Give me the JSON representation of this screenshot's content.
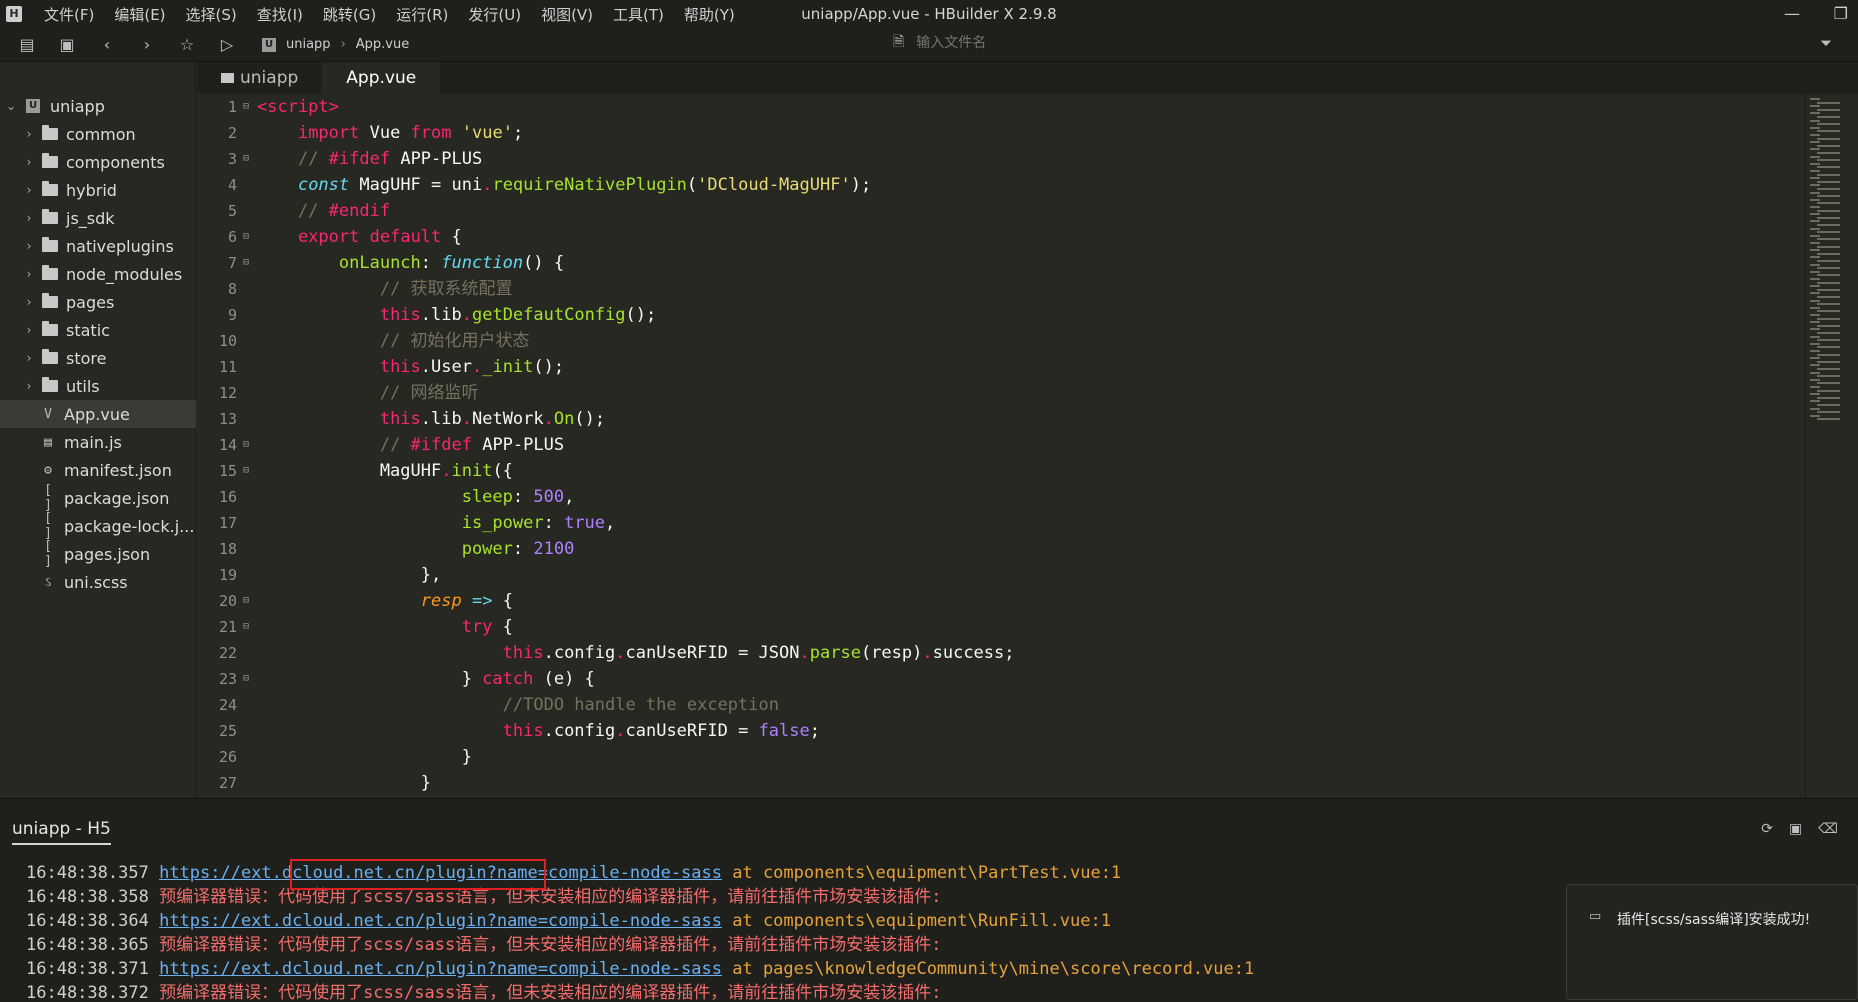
{
  "window": {
    "app_icon": "H",
    "title": "uniapp/App.vue - HBuilder X 2.9.8",
    "menu": [
      "文件(F)",
      "编辑(E)",
      "选择(S)",
      "查找(I)",
      "跳转(G)",
      "运行(R)",
      "发行(U)",
      "视图(V)",
      "工具(T)",
      "帮助(Y)"
    ]
  },
  "toolbar": {
    "breadcrumb_logo": "U",
    "breadcrumb": [
      "uniapp",
      "App.vue"
    ],
    "file_search_placeholder": "输入文件名"
  },
  "sidebar": {
    "root": "uniapp",
    "folders": [
      "common",
      "components",
      "hybrid",
      "js_sdk",
      "nativeplugins",
      "node_modules",
      "pages",
      "static",
      "store",
      "utils"
    ],
    "files": [
      {
        "name": "App.vue",
        "icon": "vue-file-icon",
        "glyph": "V",
        "selected": true
      },
      {
        "name": "main.js",
        "icon": "js-file-icon",
        "glyph": "▤",
        "selected": false
      },
      {
        "name": "manifest.json",
        "icon": "manifest-file-icon",
        "glyph": "⚙",
        "selected": false
      },
      {
        "name": "package.json",
        "icon": "json-file-icon",
        "glyph": "[ ]",
        "selected": false
      },
      {
        "name": "package-lock.j...",
        "icon": "json-file-icon",
        "glyph": "[ ]",
        "selected": false
      },
      {
        "name": "pages.json",
        "icon": "json-file-icon",
        "glyph": "[ ]",
        "selected": false
      },
      {
        "name": "uni.scss",
        "icon": "scss-file-icon",
        "glyph": "ઽ",
        "selected": false
      }
    ]
  },
  "tabs": [
    {
      "label": "uniapp",
      "active": false
    },
    {
      "label": "App.vue",
      "active": true
    }
  ],
  "code_lines": [
    {
      "n": "1",
      "fold": true,
      "html": "<span class=\"kw\">&lt;script&gt;</span>"
    },
    {
      "n": "2",
      "fold": false,
      "html": "    <span class=\"kw\">import</span> Vue <span class=\"kw\">from</span> <span class=\"str\">'vue'</span>;"
    },
    {
      "n": "3",
      "fold": true,
      "html": "    <span class=\"cm\">// </span><span class=\"kw\">#ifdef</span> APP-PLUS"
    },
    {
      "n": "4",
      "fold": false,
      "html": "    <span class=\"it\">const</span> MagUHF = uni<span class=\"kw\">.</span><span class=\"fn\">requireNativePlugin</span>(<span class=\"str\">'DCloud-MagUHF'</span>);"
    },
    {
      "n": "5",
      "fold": false,
      "html": "    <span class=\"cm\">// </span><span class=\"kw\">#endif</span>"
    },
    {
      "n": "6",
      "fold": true,
      "html": "    <span class=\"kw\">export</span> <span class=\"kw\">default</span> {"
    },
    {
      "n": "7",
      "fold": true,
      "html": "        <span class=\"prop\">onLaunch</span>: <span class=\"it\">function</span>() {"
    },
    {
      "n": "8",
      "fold": false,
      "html": "            <span class=\"cm\">// 获取系统配置</span>"
    },
    {
      "n": "9",
      "fold": false,
      "html": "            <span class=\"kw\">this</span>.lib<span class=\"kw\">.</span><span class=\"fn\">getDefautConfig</span>();"
    },
    {
      "n": "10",
      "fold": false,
      "html": "            <span class=\"cm\">// 初始化用户状态</span>"
    },
    {
      "n": "11",
      "fold": false,
      "html": "            <span class=\"kw\">this</span>.User<span class=\"kw\">.</span><span class=\"fn\">_init</span>();"
    },
    {
      "n": "12",
      "fold": false,
      "html": "            <span class=\"cm\">// 网络监听</span>"
    },
    {
      "n": "13",
      "fold": false,
      "html": "            <span class=\"kw\">this</span>.lib<span class=\"kw\">.</span>NetWork<span class=\"kw\">.</span><span class=\"fn\">On</span>();"
    },
    {
      "n": "14",
      "fold": true,
      "html": "            <span class=\"cm\">// </span><span class=\"kw\">#ifdef</span> APP-PLUS"
    },
    {
      "n": "15",
      "fold": true,
      "html": "            MagUHF<span class=\"kw\">.</span><span class=\"fn\">init</span>({"
    },
    {
      "n": "16",
      "fold": false,
      "html": "                    <span class=\"prop\">sleep</span>: <span class=\"num\">500</span>,"
    },
    {
      "n": "17",
      "fold": false,
      "html": "                    <span class=\"prop\">is_power</span>: <span class=\"num\">true</span>,"
    },
    {
      "n": "18",
      "fold": false,
      "html": "                    <span class=\"prop\">power</span>: <span class=\"num\">2100</span>"
    },
    {
      "n": "19",
      "fold": false,
      "html": "                },"
    },
    {
      "n": "20",
      "fold": true,
      "html": "                <span class=\"param\">resp</span> <span class=\"it\">=&gt;</span> {"
    },
    {
      "n": "21",
      "fold": true,
      "html": "                    <span class=\"kw\">try</span> {"
    },
    {
      "n": "22",
      "fold": false,
      "html": "                        <span class=\"kw\">this</span>.config<span class=\"kw\">.</span>canUseRFID = JSON<span class=\"kw\">.</span><span class=\"fn\">parse</span>(resp)<span class=\"kw\">.</span>success;"
    },
    {
      "n": "23",
      "fold": true,
      "html": "                    } <span class=\"kw\">catch</span> (e) {"
    },
    {
      "n": "24",
      "fold": false,
      "html": "                        <span class=\"cm\">//TODO handle the exception</span>"
    },
    {
      "n": "25",
      "fold": false,
      "html": "                        <span class=\"kw\">this</span>.config<span class=\"kw\">.</span>canUseRFID = <span class=\"num\">false</span>;"
    },
    {
      "n": "26",
      "fold": false,
      "html": "                    }"
    },
    {
      "n": "27",
      "fold": false,
      "html": "                }"
    }
  ],
  "console": {
    "tab": "uniapp - H5",
    "lines": [
      {
        "ts": "16:48:38.357",
        "kind": "link",
        "link": "https://ext.dcloud.net.cn/plugin?name=compile-node-sass",
        "rest": " at components\\equipment\\PartTest.vue:1"
      },
      {
        "ts": "16:48:38.358",
        "kind": "err",
        "text": "预编译器错误：代码使用了scss/sass语言，但未安装相应的编译器插件，请前往插件市场安装该插件:"
      },
      {
        "ts": "16:48:38.364",
        "kind": "link",
        "link": "https://ext.dcloud.net.cn/plugin?name=compile-node-sass",
        "rest": " at components\\equipment\\RunFill.vue:1"
      },
      {
        "ts": "16:48:38.365",
        "kind": "err",
        "text": "预编译器错误：代码使用了scss/sass语言，但未安装相应的编译器插件，请前往插件市场安装该插件:"
      },
      {
        "ts": "16:48:38.371",
        "kind": "link",
        "link": "https://ext.dcloud.net.cn/plugin?name=compile-node-sass",
        "rest": " at pages\\knowledgeCommunity\\mine\\score\\record.vue:1"
      },
      {
        "ts": "16:48:38.372",
        "kind": "err",
        "text": "预编译器错误：代码使用了scss/sass语言，但未安装相应的编译器插件，请前往插件市场安装该插件:"
      }
    ]
  },
  "notification": {
    "text": "插件[scss/sass编译]安装成功!"
  }
}
